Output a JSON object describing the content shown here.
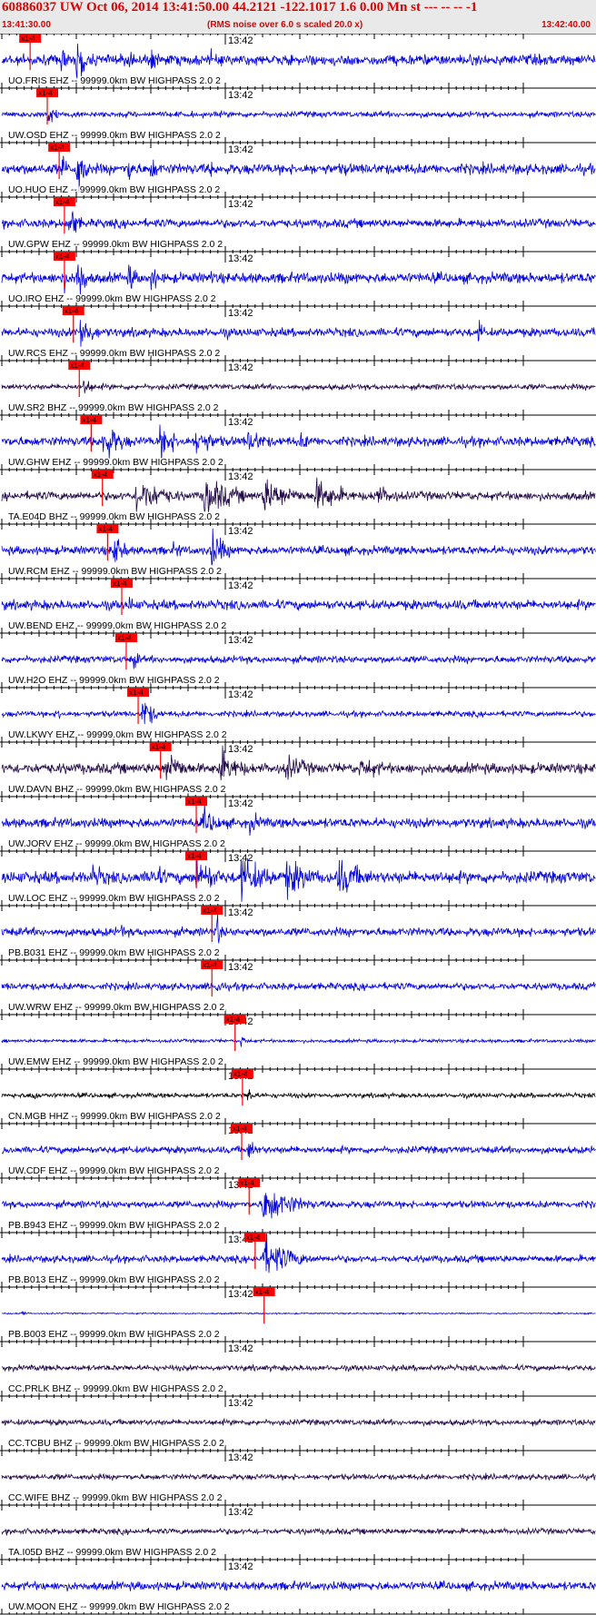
{
  "header": {
    "title": "60886037 UW Oct 06, 2014 13:41:50.00   44.2121 -122.1017  1.6 0.00 Mn st --- -- --   -1",
    "start_time": "13:41:30.00",
    "scale_note": "(RMS noise over 6.0 s scaled 20.0 x)",
    "end_time": "13:42:40.00"
  },
  "colors": {
    "trace_blue": "#0000e6",
    "trace_dark": "#230a4a",
    "trace_black": "#000000",
    "pick_red": "#ff0000",
    "header_bg": "#e9e9e9"
  },
  "chart_data": {
    "type": "line",
    "description_kind": "seismogram record section",
    "t_start": "13:41:30.00",
    "t_end": "13:42:40.00",
    "minute_label": "13:42",
    "pick_label": "x1-4",
    "rows": [
      {
        "label": "UO.FRIS EHZ -- 99999.0km BW  HIGHPASS  2.0  2",
        "pick_s": 3.8,
        "color": "blue",
        "amp": 0.22,
        "events": [
          [
            8,
            0.9,
            0.7
          ],
          [
            10,
            1.6,
            1.0
          ],
          [
            12.5,
            0.4,
            0.4
          ],
          [
            17,
            0.9,
            0.9
          ],
          [
            20,
            0.8,
            0.9
          ],
          [
            28,
            0.5,
            0.5
          ],
          [
            46,
            0.5,
            0.4
          ],
          [
            58,
            0.4,
            0.4
          ],
          [
            66,
            0.4,
            0.4
          ]
        ]
      },
      {
        "label": "UW.OSD EHZ -- 99999.0km BW  HIGHPASS  2.0  2",
        "pick_s": 6.1,
        "color": "blue",
        "amp": 0.12,
        "events": [
          [
            6.2,
            0.8,
            0.8
          ]
        ]
      },
      {
        "label": "UO.HUO EHZ -- 99999.0km BW  HIGHPASS  2.0  2",
        "pick_s": 7.7,
        "color": "blue",
        "amp": 0.22,
        "events": [
          [
            8,
            0.9,
            0.7
          ],
          [
            10,
            1.6,
            1.0
          ],
          [
            17,
            0.9,
            0.9
          ],
          [
            20,
            0.8,
            0.9
          ],
          [
            28,
            0.5,
            0.5
          ],
          [
            46,
            0.5,
            0.4
          ],
          [
            58,
            0.4,
            0.4
          ]
        ]
      },
      {
        "label": "UW.GPW EHZ -- 99999.0km BW  HIGHPASS  2.0  2",
        "pick_s": 8.4,
        "color": "blue",
        "amp": 0.18,
        "events": [
          [
            9,
            1.0,
            1.2
          ]
        ]
      },
      {
        "label": "UO.IRO EHZ -- 99999.0km BW  HIGHPASS  2.0  2",
        "pick_s": 8.4,
        "color": "blue",
        "amp": 0.22,
        "events": [
          [
            8,
            0.9,
            0.7
          ],
          [
            10,
            1.6,
            1.0
          ],
          [
            17,
            0.9,
            0.9
          ],
          [
            20,
            0.8,
            0.9
          ],
          [
            28,
            0.5,
            0.5
          ],
          [
            46,
            0.5,
            0.4
          ],
          [
            58,
            0.4,
            0.4
          ]
        ]
      },
      {
        "label": "UW.RCS EHZ -- 99999.0km BW  HIGHPASS  2.0  2",
        "pick_s": 9.6,
        "color": "blue",
        "amp": 0.18,
        "events": [
          [
            10.5,
            1.0,
            1.6
          ],
          [
            12.5,
            0.4,
            1.0
          ],
          [
            18,
            0.3,
            1.5
          ],
          [
            30,
            0.3,
            1.5
          ],
          [
            64,
            0.8,
            0.6
          ]
        ]
      },
      {
        "label": "UW.SR2 BHZ -- 99999.0km BW  HIGHPASS  2.0  2",
        "pick_s": 10.4,
        "color": "dark",
        "amp": 0.12,
        "events": [
          [
            11,
            0.6,
            1.0
          ]
        ]
      },
      {
        "label": "UW.GHW EHZ -- 99999.0km BW  HIGHPASS  2.0  2",
        "pick_s": 12.0,
        "color": "blue",
        "amp": 0.2,
        "events": [
          [
            13.5,
            1.0,
            2.5
          ],
          [
            21,
            0.9,
            2.5
          ],
          [
            26,
            0.7,
            3.0
          ],
          [
            33,
            0.6,
            3.0
          ],
          [
            40,
            0.4,
            3.0
          ]
        ]
      },
      {
        "label": "TA.E04D BHZ -- 99999.0km BW  HIGHPASS  2.0  2",
        "pick_s": 13.5,
        "color": "dark",
        "amp": 0.18,
        "events": [
          [
            18,
            0.9,
            4.0
          ],
          [
            27,
            1.0,
            4.0
          ],
          [
            35,
            0.9,
            4.0
          ],
          [
            42,
            0.8,
            4.0
          ],
          [
            50,
            0.5,
            4.0
          ]
        ]
      },
      {
        "label": "UW.RCM EHZ -- 99999.0km BW  HIGHPASS  2.0  2",
        "pick_s": 14.2,
        "color": "blue",
        "amp": 0.18,
        "events": [
          [
            14.8,
            1.0,
            1.5
          ],
          [
            23,
            0.4,
            2.0
          ],
          [
            28,
            1.0,
            2.0
          ]
        ]
      },
      {
        "label": "UW.BEND EHZ -- 99999.0km BW  HIGHPASS  2.0  2",
        "pick_s": 16.1,
        "color": "blue",
        "amp": 0.2,
        "events": [
          [
            17,
            0.4,
            2.0
          ]
        ]
      },
      {
        "label": "UW.H2O EHZ -- 99999.0km BW  HIGHPASS  2.0  2",
        "pick_s": 16.7,
        "color": "blue",
        "amp": 0.15,
        "events": [
          [
            17.5,
            0.6,
            1.0
          ]
        ]
      },
      {
        "label": "UW.LKWY EHZ -- 99999.0km BW  HIGHPASS  2.0  2",
        "pick_s": 18.3,
        "color": "blue",
        "amp": 0.12,
        "events": [
          [
            7.5,
            0.5,
            0.6
          ],
          [
            18.8,
            0.9,
            1.5
          ]
        ]
      },
      {
        "label": "UW.DAVN BHZ -- 99999.0km BW  HIGHPASS  2.0  2",
        "pick_s": 21.3,
        "color": "dark",
        "amp": 0.22,
        "events": [
          [
            22,
            0.9,
            2.5
          ],
          [
            29,
            0.9,
            3.0
          ],
          [
            38,
            0.6,
            4.0
          ],
          [
            48,
            0.5,
            5.0
          ]
        ]
      },
      {
        "label": "UW.JORV EHZ -- 99999.0km BW  HIGHPASS  2.0  2",
        "pick_s": 26.1,
        "color": "blue",
        "amp": 0.2,
        "events": [
          [
            27,
            0.7,
            2.5
          ],
          [
            33,
            0.5,
            3.0
          ]
        ]
      },
      {
        "label": "UW.LOC EHZ -- 99999.0km BW  HIGHPASS  2.0  2",
        "pick_s": 26.1,
        "color": "blue",
        "amp": 0.25,
        "events": [
          [
            12,
            0.6,
            3.0
          ],
          [
            20,
            0.6,
            3.0
          ],
          [
            26,
            1.0,
            3.0
          ],
          [
            32,
            1.0,
            4.0
          ],
          [
            38,
            0.9,
            4.0
          ],
          [
            45,
            0.9,
            4.0
          ]
        ]
      },
      {
        "label": "PB.B031 EHZ -- 99999.0km BW  HIGHPASS  2.0  2",
        "pick_s": 28.2,
        "color": "blue",
        "amp": 0.18,
        "events": [
          [
            16,
            0.4,
            1.0
          ],
          [
            28.8,
            1.0,
            0.6
          ]
        ]
      },
      {
        "label": "UW.WRW EHZ -- 99999.0km BW  HIGHPASS  2.0  2",
        "pick_s": 28.2,
        "color": "blue",
        "amp": 0.15,
        "events": [
          [
            28.8,
            0.6,
            0.8
          ]
        ]
      },
      {
        "label": "UW.EMW EHZ -- 99999.0km BW  HIGHPASS  2.0  2",
        "pick_s": 31.3,
        "color": "blue",
        "amp": 0.07,
        "events": [
          [
            32,
            0.3,
            1.0
          ]
        ]
      },
      {
        "label": "CN.MGB HHZ -- 99999.0km BW  HIGHPASS  2.0  2",
        "pick_s": 32.3,
        "color": "black",
        "amp": 0.1,
        "events": [
          [
            4,
            0.4,
            1.0
          ],
          [
            33,
            0.5,
            0.8
          ]
        ]
      },
      {
        "label": "UW.CDF EHZ -- 99999.0km BW  HIGHPASS  2.0  2",
        "pick_s": 32.2,
        "color": "blue",
        "amp": 0.15,
        "events": [
          [
            33,
            0.6,
            1.2
          ]
        ]
      },
      {
        "label": "PB.B943 EHZ -- 99999.0km BW  HIGHPASS  2.0  2",
        "pick_s": 33.2,
        "color": "blue",
        "amp": 0.15,
        "events": [
          [
            35,
            1.0,
            4.0
          ]
        ]
      },
      {
        "label": "PB.B013 EHZ -- 99999.0km BW  HIGHPASS  2.0  2",
        "pick_s": 34.0,
        "color": "blue",
        "amp": 0.15,
        "events": [
          [
            35,
            1.0,
            4.0
          ]
        ]
      },
      {
        "label": "PB.B003 EHZ -- 99999.0km BW  HIGHPASS  2.0  2",
        "pick_s": 35.2,
        "color": "blue",
        "amp": 0.03,
        "events": [
          [
            2.5,
            0.25,
            0.5
          ]
        ]
      },
      {
        "label": "CC.PRLK BHZ -- 99999.0km BW  HIGHPASS  2.0  2",
        "pick_s": null,
        "color": "dark",
        "amp": 0.12,
        "events": []
      },
      {
        "label": "CC.TCBU BHZ -- 99999.0km BW  HIGHPASS  2.0  2",
        "pick_s": null,
        "color": "dark",
        "amp": 0.12,
        "events": []
      },
      {
        "label": "CC.WIFE BHZ -- 99999.0km BW  HIGHPASS  2.0  2",
        "pick_s": null,
        "color": "dark",
        "amp": 0.12,
        "events": []
      },
      {
        "label": "TA.I05D BHZ -- 99999.0km BW  HIGHPASS  2.0  2",
        "pick_s": null,
        "color": "dark",
        "amp": 0.12,
        "events": []
      },
      {
        "label": "UW.MOON EHZ -- 99999.0km BW  HIGHPASS  2.0  2",
        "pick_s": null,
        "color": "blue",
        "amp": 0.18,
        "events": []
      }
    ]
  }
}
